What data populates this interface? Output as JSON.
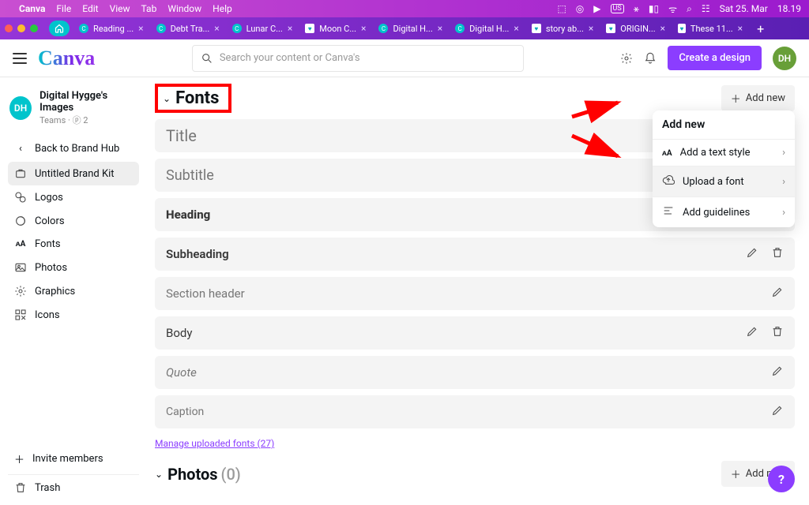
{
  "mac_menu": {
    "app": "Canva",
    "items": [
      "File",
      "Edit",
      "View",
      "Tab",
      "Window",
      "Help"
    ],
    "date": "Sat 25. Mar",
    "time": "18.19"
  },
  "browser": {
    "tabs": [
      {
        "fav": "c",
        "label": "Reading ..."
      },
      {
        "fav": "c",
        "label": "Debt Tra..."
      },
      {
        "fav": "c",
        "label": "Lunar C..."
      },
      {
        "fav": "t",
        "label": "Moon C..."
      },
      {
        "fav": "c",
        "label": "Digital H..."
      },
      {
        "fav": "c",
        "label": "Digital H..."
      },
      {
        "fav": "t",
        "label": "story ab..."
      },
      {
        "fav": "t",
        "label": "ORIGIN..."
      },
      {
        "fav": "t",
        "label": "These 11..."
      }
    ]
  },
  "topbar": {
    "search_placeholder": "Search your content or Canva's",
    "create": "Create a design",
    "avatar": "DH"
  },
  "sidebar": {
    "team": {
      "badge": "DH",
      "name": "Digital Hygge's Images",
      "sub": "Teams  ·  ⓟ 2"
    },
    "back": "Back to Brand Hub",
    "items": [
      {
        "key": "kit",
        "label": "Untitled Brand Kit",
        "active": true
      },
      {
        "key": "logos",
        "label": "Logos"
      },
      {
        "key": "colors",
        "label": "Colors"
      },
      {
        "key": "fonts",
        "label": "Fonts"
      },
      {
        "key": "photos",
        "label": "Photos"
      },
      {
        "key": "graphics",
        "label": "Graphics"
      },
      {
        "key": "icons",
        "label": "Icons"
      }
    ],
    "footer": {
      "invite": "Invite members",
      "trash": "Trash"
    }
  },
  "main": {
    "section_title": "Fonts",
    "add_new": "Add new",
    "styles": [
      {
        "key": "title",
        "label": "Title",
        "cls": "sr-title",
        "edit": false,
        "del": false
      },
      {
        "key": "subtitle",
        "label": "Subtitle",
        "cls": "sr-subtitle",
        "edit": false,
        "del": false
      },
      {
        "key": "heading",
        "label": "Heading",
        "cls": "sr-heading",
        "edit": true,
        "del": true
      },
      {
        "key": "subheading",
        "label": "Subheading",
        "cls": "sr-subheading",
        "edit": true,
        "del": true
      },
      {
        "key": "section",
        "label": "Section header",
        "cls": "sr-section",
        "edit": true,
        "del": false
      },
      {
        "key": "body",
        "label": "Body",
        "cls": "sr-body",
        "edit": true,
        "del": true
      },
      {
        "key": "quote",
        "label": "Quote",
        "cls": "sr-quote",
        "edit": true,
        "del": false
      },
      {
        "key": "caption",
        "label": "Caption",
        "cls": "sr-caption",
        "edit": true,
        "del": false
      }
    ],
    "manage_link": "Manage uploaded fonts (27)",
    "photos_title": "Photos",
    "photos_count": "(0)"
  },
  "popover": {
    "header": "Add new",
    "items": [
      {
        "label": "Add a text style",
        "hl": false,
        "icon": "text"
      },
      {
        "label": "Upload a font",
        "hl": true,
        "icon": "upload"
      },
      {
        "label": "Add guidelines",
        "hl": false,
        "icon": "lines"
      }
    ]
  }
}
